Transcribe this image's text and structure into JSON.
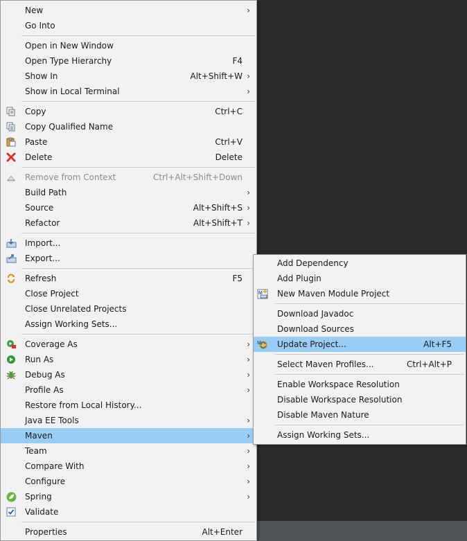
{
  "main_menu": {
    "groups": [
      [
        {
          "label": "New",
          "accel": "",
          "submenu": true,
          "icon": ""
        },
        {
          "label": "Go Into",
          "accel": "",
          "submenu": false,
          "icon": ""
        }
      ],
      [
        {
          "label": "Open in New Window",
          "accel": "",
          "submenu": false,
          "icon": ""
        },
        {
          "label": "Open Type Hierarchy",
          "accel": "F4",
          "submenu": false,
          "icon": ""
        },
        {
          "label": "Show In",
          "accel": "Alt+Shift+W",
          "submenu": true,
          "icon": ""
        },
        {
          "label": "Show in Local Terminal",
          "accel": "",
          "submenu": true,
          "icon": ""
        }
      ],
      [
        {
          "label": "Copy",
          "accel": "Ctrl+C",
          "submenu": false,
          "icon": "copy-icon"
        },
        {
          "label": "Copy Qualified Name",
          "accel": "",
          "submenu": false,
          "icon": "copy-qualified-icon"
        },
        {
          "label": "Paste",
          "accel": "Ctrl+V",
          "submenu": false,
          "icon": "paste-icon"
        },
        {
          "label": "Delete",
          "accel": "Delete",
          "submenu": false,
          "icon": "delete-icon"
        }
      ],
      [
        {
          "label": "Remove from Context",
          "accel": "Ctrl+Alt+Shift+Down",
          "submenu": false,
          "icon": "remove-context-icon",
          "disabled": true
        },
        {
          "label": "Build Path",
          "accel": "",
          "submenu": true,
          "icon": ""
        },
        {
          "label": "Source",
          "accel": "Alt+Shift+S",
          "submenu": true,
          "icon": ""
        },
        {
          "label": "Refactor",
          "accel": "Alt+Shift+T",
          "submenu": true,
          "icon": ""
        }
      ],
      [
        {
          "label": "Import...",
          "accel": "",
          "submenu": false,
          "icon": "import-icon"
        },
        {
          "label": "Export...",
          "accel": "",
          "submenu": false,
          "icon": "export-icon"
        }
      ],
      [
        {
          "label": "Refresh",
          "accel": "F5",
          "submenu": false,
          "icon": "refresh-icon"
        },
        {
          "label": "Close Project",
          "accel": "",
          "submenu": false,
          "icon": ""
        },
        {
          "label": "Close Unrelated Projects",
          "accel": "",
          "submenu": false,
          "icon": ""
        },
        {
          "label": "Assign Working Sets...",
          "accel": "",
          "submenu": false,
          "icon": ""
        }
      ],
      [
        {
          "label": "Coverage As",
          "accel": "",
          "submenu": true,
          "icon": "coverage-icon"
        },
        {
          "label": "Run As",
          "accel": "",
          "submenu": true,
          "icon": "run-icon"
        },
        {
          "label": "Debug As",
          "accel": "",
          "submenu": true,
          "icon": "debug-icon"
        },
        {
          "label": "Profile As",
          "accel": "",
          "submenu": true,
          "icon": ""
        },
        {
          "label": "Restore from Local History...",
          "accel": "",
          "submenu": false,
          "icon": ""
        },
        {
          "label": "Java EE Tools",
          "accel": "",
          "submenu": true,
          "icon": ""
        },
        {
          "label": "Maven",
          "accel": "",
          "submenu": true,
          "icon": "",
          "highlighted": true
        },
        {
          "label": "Team",
          "accel": "",
          "submenu": true,
          "icon": ""
        },
        {
          "label": "Compare With",
          "accel": "",
          "submenu": true,
          "icon": ""
        },
        {
          "label": "Configure",
          "accel": "",
          "submenu": true,
          "icon": ""
        },
        {
          "label": "Spring",
          "accel": "",
          "submenu": true,
          "icon": "spring-icon"
        },
        {
          "label": "Validate",
          "accel": "",
          "submenu": false,
          "icon": "validate-check-icon"
        }
      ],
      [
        {
          "label": "Properties",
          "accel": "Alt+Enter",
          "submenu": false,
          "icon": ""
        }
      ]
    ]
  },
  "maven_menu": {
    "groups": [
      [
        {
          "label": "Add Dependency",
          "accel": "",
          "icon": ""
        },
        {
          "label": "Add Plugin",
          "accel": "",
          "icon": ""
        },
        {
          "label": "New Maven Module Project",
          "accel": "",
          "icon": "maven-module-icon"
        }
      ],
      [
        {
          "label": "Download Javadoc",
          "accel": "",
          "icon": ""
        },
        {
          "label": "Download Sources",
          "accel": "",
          "icon": ""
        },
        {
          "label": "Update Project...",
          "accel": "Alt+F5",
          "icon": "update-project-icon",
          "highlighted": true
        }
      ],
      [
        {
          "label": "Select Maven Profiles...",
          "accel": "Ctrl+Alt+P",
          "icon": ""
        }
      ],
      [
        {
          "label": "Enable Workspace Resolution",
          "accel": "",
          "icon": ""
        },
        {
          "label": "Disable Workspace Resolution",
          "accel": "",
          "icon": ""
        },
        {
          "label": "Disable Maven Nature",
          "accel": "",
          "icon": ""
        }
      ],
      [
        {
          "label": "Assign Working Sets...",
          "accel": "",
          "icon": ""
        }
      ]
    ]
  },
  "colors": {
    "highlight": "#99cdf5",
    "menu_bg": "#f2f2f2",
    "editor_bg": "#2b2b2b"
  }
}
